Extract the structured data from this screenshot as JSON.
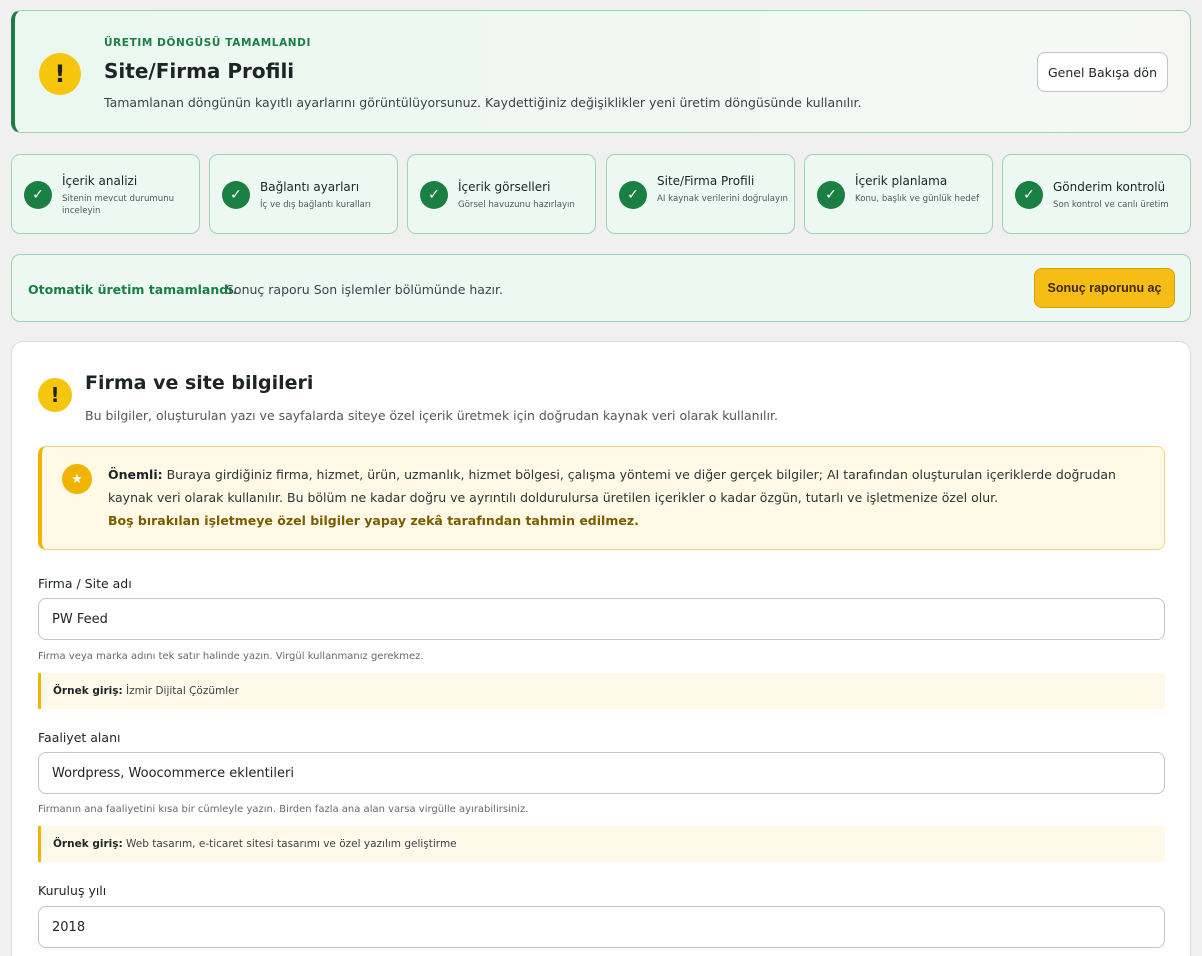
{
  "hero": {
    "kicker": "Üretim döngüsü tamamlandı",
    "title": "Site/Firma Profili",
    "description": "Tamamlanan döngünün kayıtlı ayarlarını görüntülüyorsunuz. Kaydettiğiniz değişiklikler yeni üretim döngüsünde kullanılır.",
    "back_button": "Genel Bakışa dön",
    "icon": "warning-icon"
  },
  "steps": [
    {
      "title": "İçerik analizi",
      "subtitle": "Sitenin mevcut durumunu inceleyin",
      "status": "done"
    },
    {
      "title": "Bağlantı ayarları",
      "subtitle": "İç ve dış bağlantı kuralları",
      "status": "done"
    },
    {
      "title": "İçerik görselleri",
      "subtitle": "Görsel havuzunu hazırlayın",
      "status": "done"
    },
    {
      "title": "Site/Firma Profili",
      "subtitle": "AI kaynak verilerini doğrulayın",
      "status": "done"
    },
    {
      "title": "İçerik planlama",
      "subtitle": "Konu, başlık ve günlük hedef",
      "status": "done"
    },
    {
      "title": "Gönderim kontrolü",
      "subtitle": "Son kontrol ve canlı üretim",
      "status": "done"
    }
  ],
  "banner": {
    "strong": "Otomatik üretim tamamlandı.",
    "text": "Sonuç raporu Son işlemler bölümünde hazır.",
    "button": "Sonuç raporunu aç"
  },
  "card": {
    "title": "Firma ve site bilgileri",
    "description": "Bu bilgiler, oluşturulan yazı ve sayfalarda siteye özel içerik üretmek için doğrudan kaynak veri olarak kullanılır.",
    "notice": {
      "label": "Önemli:",
      "text": " Buraya girdiğiniz firma, hizmet, ürün, uzmanlık, hizmet bölgesi, çalışma yöntemi ve diğer gerçek bilgiler; AI tarafından oluşturulan içeriklerde doğrudan kaynak veri olarak kullanılır. Bu bölüm ne kadar doğru ve ayrıntılı doldurulursa üretilen içerikler o kadar özgün, tutarlı ve işletmenize özel olur.",
      "warning": "Boş bırakılan işletmeye özel bilgiler yapay zekâ tarafından tahmin edilmez."
    },
    "fields": [
      {
        "label": "Firma / Site adı",
        "value": "PW Feed",
        "help": "Firma veya marka adını tek satır halinde yazın. Virgül kullanmanız gerekmez.",
        "example_label": "Örnek giriş:",
        "example": "İzmir Dijital Çözümler"
      },
      {
        "label": "Faaliyet alanı",
        "value": "Wordpress, Woocommerce eklentileri",
        "help": "Firmanın ana faaliyetini kısa bir cümleyle yazın. Birden fazla ana alan varsa virgülle ayırabilirsiniz.",
        "example_label": "Örnek giriş:",
        "example": "Web tasarım, e-ticaret sitesi tasarımı ve özel yazılım geliştirme"
      },
      {
        "label": "Kuruluş yılı",
        "value": "2018"
      }
    ]
  },
  "colors": {
    "brand_green": "#1a7f43",
    "accent_yellow": "#f6bd16",
    "warning_yellow": "#f6c50e"
  }
}
